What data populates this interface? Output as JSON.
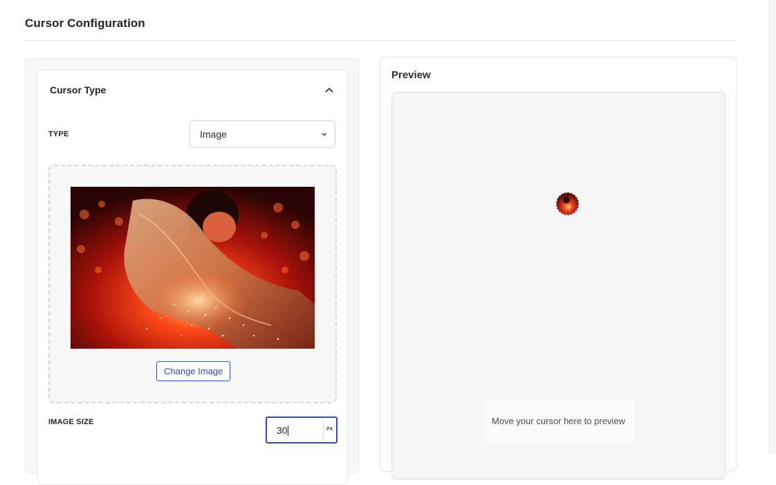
{
  "page": {
    "title": "Cursor Configuration"
  },
  "cursor_type_card": {
    "header": "Cursor Type",
    "collapse_icon": "chevron-up-icon",
    "type_label": "TYPE",
    "type_value": "Image",
    "change_image_label": "Change Image",
    "image_size_label": "IMAGE SIZE",
    "image_size_value": "30",
    "image_size_unit": "PX",
    "image_description": "woman in shimmering robe leaning over glowing red lights"
  },
  "preview": {
    "title": "Preview",
    "hint": "Move your cursor here to preview"
  },
  "colors": {
    "accent": "#2f49b8",
    "image_glow": "#ff3a1a"
  }
}
